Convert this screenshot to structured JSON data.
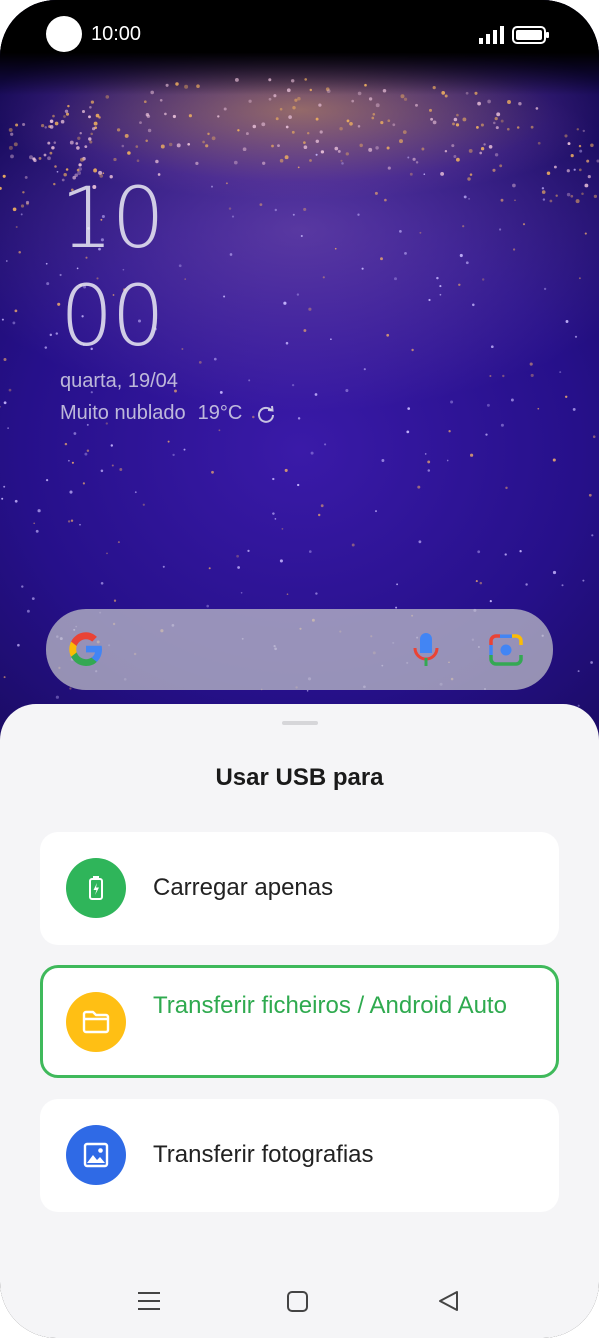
{
  "status_bar": {
    "time": "10:00",
    "icons": [
      "camera-dot",
      "signal-icon",
      "battery-icon"
    ]
  },
  "lockscreen": {
    "clock_hour": "10",
    "clock_minute": "00",
    "date": "quarta, 19/04",
    "weather_condition": "Muito nublado",
    "weather_temp": "19°C"
  },
  "search_bar": {
    "icons": [
      "google-g-icon",
      "mic-icon",
      "google-lens-icon"
    ]
  },
  "usb_sheet": {
    "title": "Usar USB para",
    "options": [
      {
        "label": "Carregar apenas",
        "icon": "battery-charging-icon",
        "color": "#2fb55a",
        "selected": false
      },
      {
        "label": "Transferir ficheiros / Android Auto",
        "icon": "folder-icon",
        "color": "#ffbf14",
        "selected": true
      },
      {
        "label": "Transferir fotografias",
        "icon": "image-icon",
        "color": "#2f6ae6",
        "selected": false
      }
    ],
    "selected_color": "#3fb95b"
  },
  "nav_bar": {
    "icons": [
      "menu-icon",
      "home-icon",
      "back-icon"
    ]
  }
}
